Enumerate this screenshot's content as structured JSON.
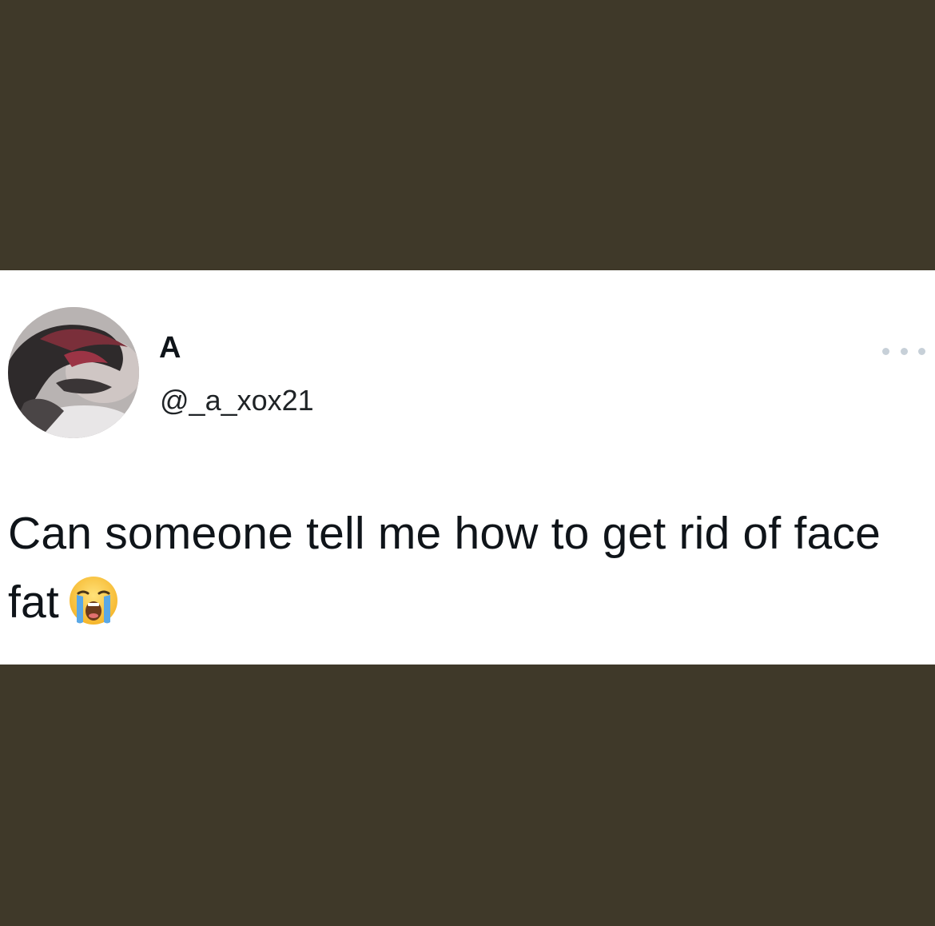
{
  "tweet": {
    "display_name": "A",
    "handle": "@_a_xox21",
    "text": "Can someone tell me how to get rid of face fat",
    "emoji": "loudly-crying-face-emoji"
  },
  "more_menu": {
    "icon": "more-options-icon"
  },
  "avatar": {
    "icon": "profile-avatar"
  },
  "colors": {
    "band_background": "#3f3929",
    "card_background": "#ffffff",
    "text_primary": "#0f1419",
    "menu_dots": "#c7d0d8"
  }
}
